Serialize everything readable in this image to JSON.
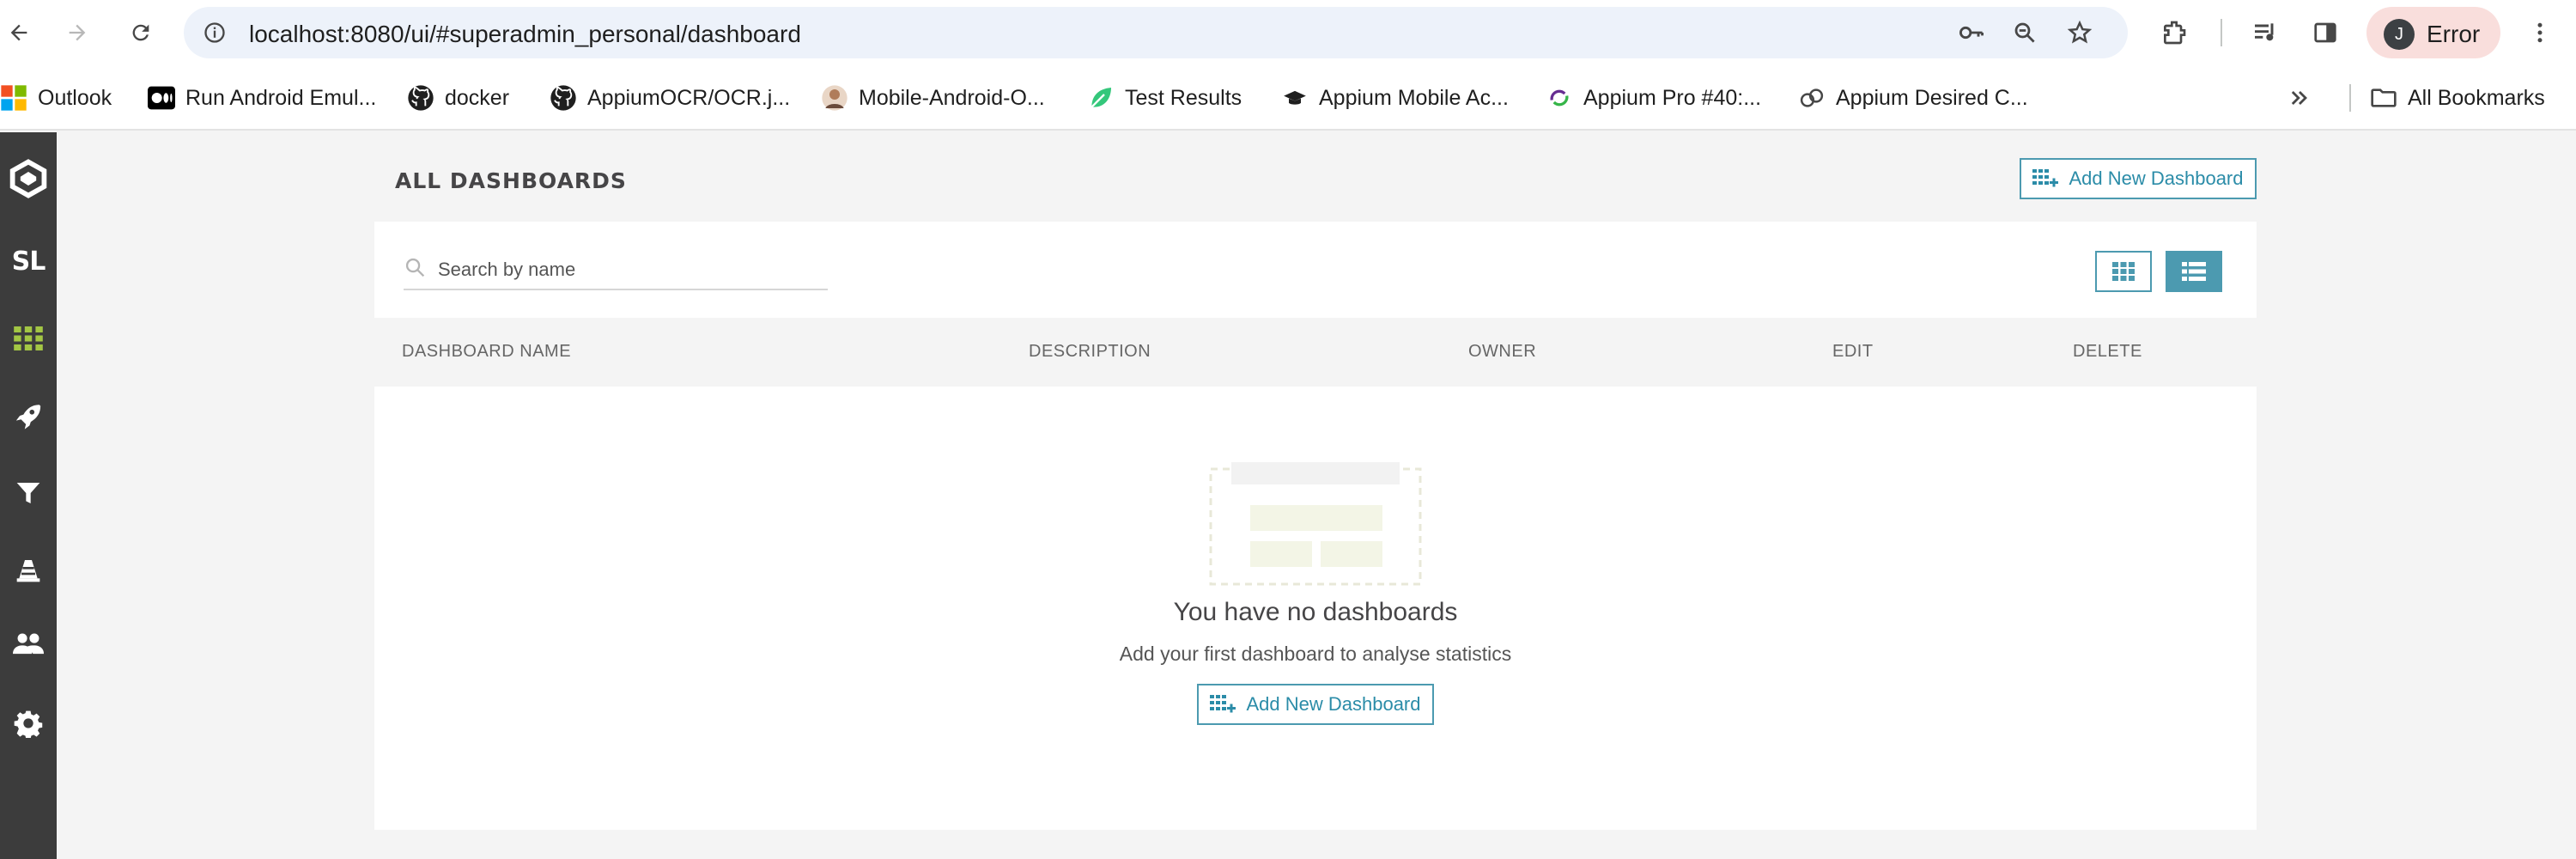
{
  "browser": {
    "url": "localhost:8080/ui/#superadmin_personal/dashboard",
    "profile_initial": "J",
    "profile_label": "Error"
  },
  "bookmarks": {
    "items": [
      {
        "label": "Outlook",
        "icon": "outlook-icon"
      },
      {
        "label": "Run Android Emul...",
        "icon": "medium-icon"
      },
      {
        "label": "docker",
        "icon": "github-icon"
      },
      {
        "label": "AppiumOCR/OCR.j...",
        "icon": "github-icon"
      },
      {
        "label": "Mobile-Android-O...",
        "icon": "avatar-icon"
      },
      {
        "label": "Test Results",
        "icon": "leaf-icon"
      },
      {
        "label": "Appium Mobile Ac...",
        "icon": "graduation-cap-icon"
      },
      {
        "label": "Appium Pro #40:...",
        "icon": "appium-icon"
      },
      {
        "label": "Appium Desired C...",
        "icon": "link-icon"
      }
    ],
    "all_bookmarks": "All Bookmarks"
  },
  "sidebar": {
    "brand_short": "SL"
  },
  "page": {
    "title": "ALL DASHBOARDS",
    "add_button": "Add New Dashboard",
    "search_placeholder": "Search by name",
    "columns": [
      "DASHBOARD NAME",
      "DESCRIPTION",
      "OWNER",
      "EDIT",
      "DELETE"
    ],
    "empty_title": "You have no dashboards",
    "empty_subtitle": "Add your first dashboard to analyse statistics",
    "empty_button": "Add New Dashboard"
  },
  "colors": {
    "accent": "#4c9ab0",
    "sidebar_bg": "#3c3c3c",
    "sidebar_active": "#a3c644",
    "profile_error_bg": "#f9dedc"
  }
}
